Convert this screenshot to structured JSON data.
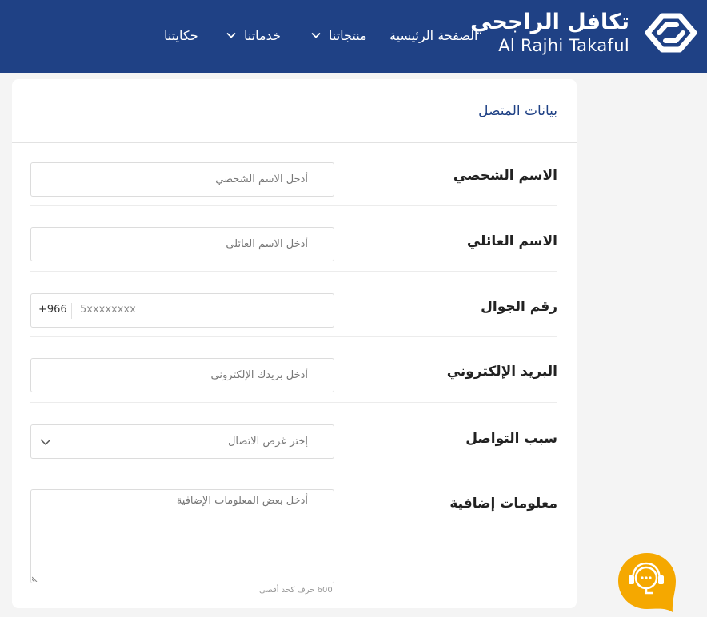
{
  "header": {
    "brand_ar": "تكافل الراجحي",
    "brand_en": "Al Rajhi Takaful",
    "nav": [
      {
        "label": "الصفحة الرئيسية"
      },
      {
        "label": "منتجاتنا"
      },
      {
        "label": "خدماتنا"
      },
      {
        "label": "حكايتنا"
      }
    ]
  },
  "form": {
    "title": "بيانات المتصل",
    "first_name": {
      "label": "الاسم الشخصي",
      "placeholder": "أدخل الاسم الشخصي"
    },
    "last_name": {
      "label": "الاسم العائلي",
      "placeholder": "أدخل الاسم العائلي"
    },
    "mobile": {
      "label": "رقم الجوال",
      "country_code": "+966",
      "placeholder": "5xxxxxxxx"
    },
    "email": {
      "label": "البريد الإلكتروني",
      "placeholder": "أدخل بريدك الإلكتروني"
    },
    "reason": {
      "label": "سبب التواصل",
      "selected": "إختر غرض الاتصال"
    },
    "additional": {
      "label": "معلومات إضافية",
      "placeholder": "أدخل بعض المعلومات الإضافية",
      "limit_text": "600 حرف كحد أقصى"
    }
  },
  "colors": {
    "brand": "#1f4185",
    "chat": "#f5a800"
  },
  "icons": [
    "logo-icon",
    "chevron-down-icon",
    "chat-support-icon"
  ]
}
